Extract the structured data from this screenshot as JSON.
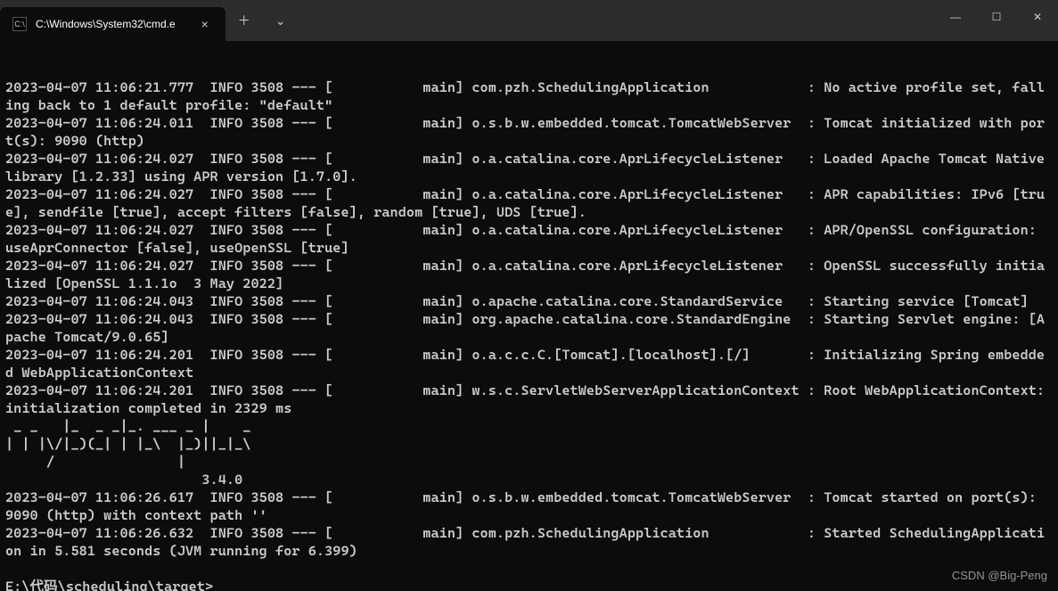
{
  "titlebar": {
    "tab_title": "C:\\Windows\\System32\\cmd.e",
    "cmd_icon_label": "C:\\",
    "close_label": "×",
    "new_tab_label": "＋",
    "dropdown_label": "⌄",
    "min_label": "—",
    "max_label": "☐",
    "close_window_label": "✕"
  },
  "log_lines": [
    "2023-04-07 11:06:21.777  INFO 3508 --- [           main] com.pzh.SchedulingApplication            : No active profile set, falling back to 1 default profile: \"default\"",
    "2023-04-07 11:06:24.011  INFO 3508 --- [           main] o.s.b.w.embedded.tomcat.TomcatWebServer  : Tomcat initialized with port(s): 9090 (http)",
    "2023-04-07 11:06:24.027  INFO 3508 --- [           main] o.a.catalina.core.AprLifecycleListener   : Loaded Apache Tomcat Native library [1.2.33] using APR version [1.7.0].",
    "2023-04-07 11:06:24.027  INFO 3508 --- [           main] o.a.catalina.core.AprLifecycleListener   : APR capabilities: IPv6 [true], sendfile [true], accept filters [false], random [true], UDS [true].",
    "2023-04-07 11:06:24.027  INFO 3508 --- [           main] o.a.catalina.core.AprLifecycleListener   : APR/OpenSSL configuration: useAprConnector [false], useOpenSSL [true]",
    "2023-04-07 11:06:24.027  INFO 3508 --- [           main] o.a.catalina.core.AprLifecycleListener   : OpenSSL successfully initialized [OpenSSL 1.1.1o  3 May 2022]",
    "2023-04-07 11:06:24.043  INFO 3508 --- [           main] o.apache.catalina.core.StandardService   : Starting service [Tomcat]",
    "2023-04-07 11:06:24.043  INFO 3508 --- [           main] org.apache.catalina.core.StandardEngine  : Starting Servlet engine: [Apache Tomcat/9.0.65]",
    "2023-04-07 11:06:24.201  INFO 3508 --- [           main] o.a.c.c.C.[Tomcat].[localhost].[/]       : Initializing Spring embedded WebApplicationContext",
    "2023-04-07 11:06:24.201  INFO 3508 --- [           main] w.s.c.ServletWebServerApplicationContext : Root WebApplicationContext: initialization completed in 2329 ms",
    " _ _   |_  _ _|_. ___ _ |    _",
    "| | |\\/|_)(_| | |_\\  |_)||_|_\\",
    "     /               |",
    "                        3.4.0",
    "2023-04-07 11:06:26.617  INFO 3508 --- [           main] o.s.b.w.embedded.tomcat.TomcatWebServer  : Tomcat started on port(s): 9090 (http) with context path ''",
    "2023-04-07 11:06:26.632  INFO 3508 --- [           main] com.pzh.SchedulingApplication            : Started SchedulingApplication in 5.581 seconds (JVM running for 6.399)",
    "",
    "E:\\代码\\scheduling\\target>"
  ],
  "watermark": "CSDN @Big-Peng"
}
